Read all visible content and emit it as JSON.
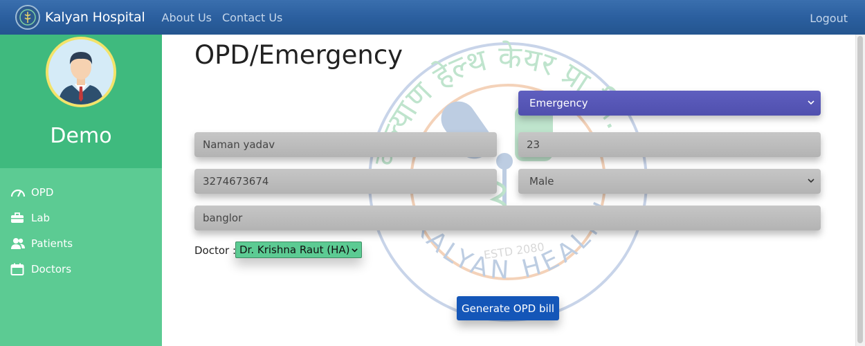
{
  "navbar": {
    "brand": "Kalyan Hospital",
    "links": [
      "About Us",
      "Contact Us"
    ],
    "logout": "Logout"
  },
  "sidebar": {
    "user_name": "Demo",
    "items": [
      {
        "label": "OPD",
        "icon": "tachometer-icon"
      },
      {
        "label": "Lab",
        "icon": "briefcase-icon"
      },
      {
        "label": "Patients",
        "icon": "users-icon"
      },
      {
        "label": "Doctors",
        "icon": "calendar-icon"
      }
    ]
  },
  "main": {
    "title": "OPD/Emergency",
    "visit_type": "Emergency",
    "name": "Naman yadav",
    "age": "23",
    "phone": "3274673674",
    "gender": "Male",
    "address": "banglor",
    "doctor_label": "Doctor :",
    "doctor": "Dr. Krishna Raut (HA)",
    "generate_button": "Generate OPD bill"
  },
  "watermark": {
    "arc_text_top": "कल्याण हेल्थ केयर प्रा.लि.",
    "arc_text_bottom": "KALYAN HEALTH CARE",
    "estd": "ESTD 2080"
  },
  "colors": {
    "navbar": "#2b5f9f",
    "sidebar": "#5ccb93",
    "sidebar_profile": "#3fba7e",
    "select_purple": "#5454b4",
    "button": "#1456b8"
  }
}
